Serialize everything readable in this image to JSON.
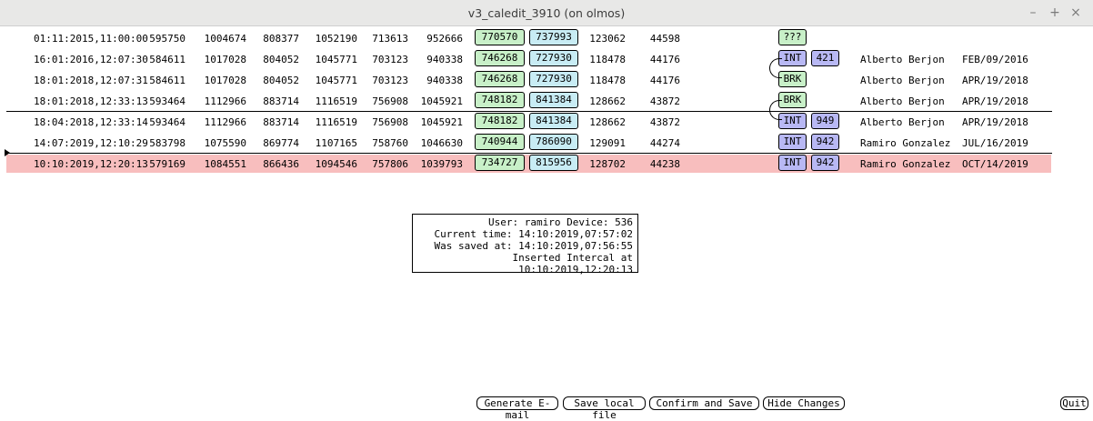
{
  "window": {
    "title": "v3_caledit_3910 (on olmos)",
    "minimize_glyph": "–",
    "maximize_glyph": "+",
    "close_glyph": "×"
  },
  "rows": [
    {
      "datetime": "01:11:2015,11:00:00",
      "c1": "595750",
      "c2": "1004674",
      "c3": "808377",
      "c4": "1052190",
      "c5": "713613",
      "c6": "952666",
      "g": "770570",
      "b": "737993",
      "c7": "123062",
      "c8": "44598",
      "tag1": "???",
      "tag2": "",
      "user": "",
      "date": ""
    },
    {
      "datetime": "16:01:2016,12:07:30",
      "c1": "584611",
      "c2": "1017028",
      "c3": "804052",
      "c4": "1045771",
      "c5": "703123",
      "c6": "940338",
      "g": "746268",
      "b": "727930",
      "c7": "118478",
      "c8": "44176",
      "tag1": "INT",
      "tag2": "421",
      "user": "Alberto Berjon",
      "date": "FEB/09/2016"
    },
    {
      "datetime": "18:01:2018,12:07:31",
      "c1": "584611",
      "c2": "1017028",
      "c3": "804052",
      "c4": "1045771",
      "c5": "703123",
      "c6": "940338",
      "g": "746268",
      "b": "727930",
      "c7": "118478",
      "c8": "44176",
      "tag1": "BRK",
      "tag2": "",
      "user": "Alberto Berjon",
      "date": "APR/19/2018"
    },
    {
      "datetime": "18:01:2018,12:33:13",
      "c1": "593464",
      "c2": "1112966",
      "c3": "883714",
      "c4": "1116519",
      "c5": "756908",
      "c6": "1045921",
      "g": "748182",
      "b": "841384",
      "c7": "128662",
      "c8": "43872",
      "tag1": "BRK",
      "tag2": "",
      "user": "Alberto Berjon",
      "date": "APR/19/2018"
    },
    {
      "datetime": "18:04:2018,12:33:14",
      "c1": "593464",
      "c2": "1112966",
      "c3": "883714",
      "c4": "1116519",
      "c5": "756908",
      "c6": "1045921",
      "g": "748182",
      "b": "841384",
      "c7": "128662",
      "c8": "43872",
      "tag1": "INT",
      "tag2": "949",
      "user": "Alberto Berjon",
      "date": "APR/19/2018"
    },
    {
      "datetime": "14:07:2019,12:10:29",
      "c1": "583798",
      "c2": "1075590",
      "c3": "869774",
      "c4": "1107165",
      "c5": "758760",
      "c6": "1046630",
      "g": "740944",
      "b": "786090",
      "c7": "129091",
      "c8": "44274",
      "tag1": "INT",
      "tag2": "942",
      "user": "Ramiro Gonzalez",
      "date": "JUL/16/2019"
    },
    {
      "datetime": "10:10:2019,12:20:13",
      "c1": "579169",
      "c2": "1084551",
      "c3": "866436",
      "c4": "1094546",
      "c5": "757806",
      "c6": "1039793",
      "g": "734727",
      "b": "815956",
      "c7": "128702",
      "c8": "44238",
      "tag1": "INT",
      "tag2": "942",
      "user": "Ramiro Gonzalez",
      "date": "OCT/14/2019"
    }
  ],
  "info": {
    "line1": "User: ramiro Device: 536",
    "line2": "Current time: 14:10:2019,07:57:02",
    "line3": "Was saved at: 14:10:2019,07:56:55",
    "line4": "Inserted Intercal at 10:10:2019,12:20:13"
  },
  "buttons": {
    "email": "Generate E-mail",
    "save_local": "Save local file",
    "confirm": "Confirm and Save",
    "hide": "Hide Changes",
    "quit": "Quit"
  },
  "colors": {
    "highlight_row": "#f8bebe",
    "green_cell": "#c8f0c8",
    "blue_cell": "#c8ecf4",
    "int_tag": "#b8b8f4"
  }
}
